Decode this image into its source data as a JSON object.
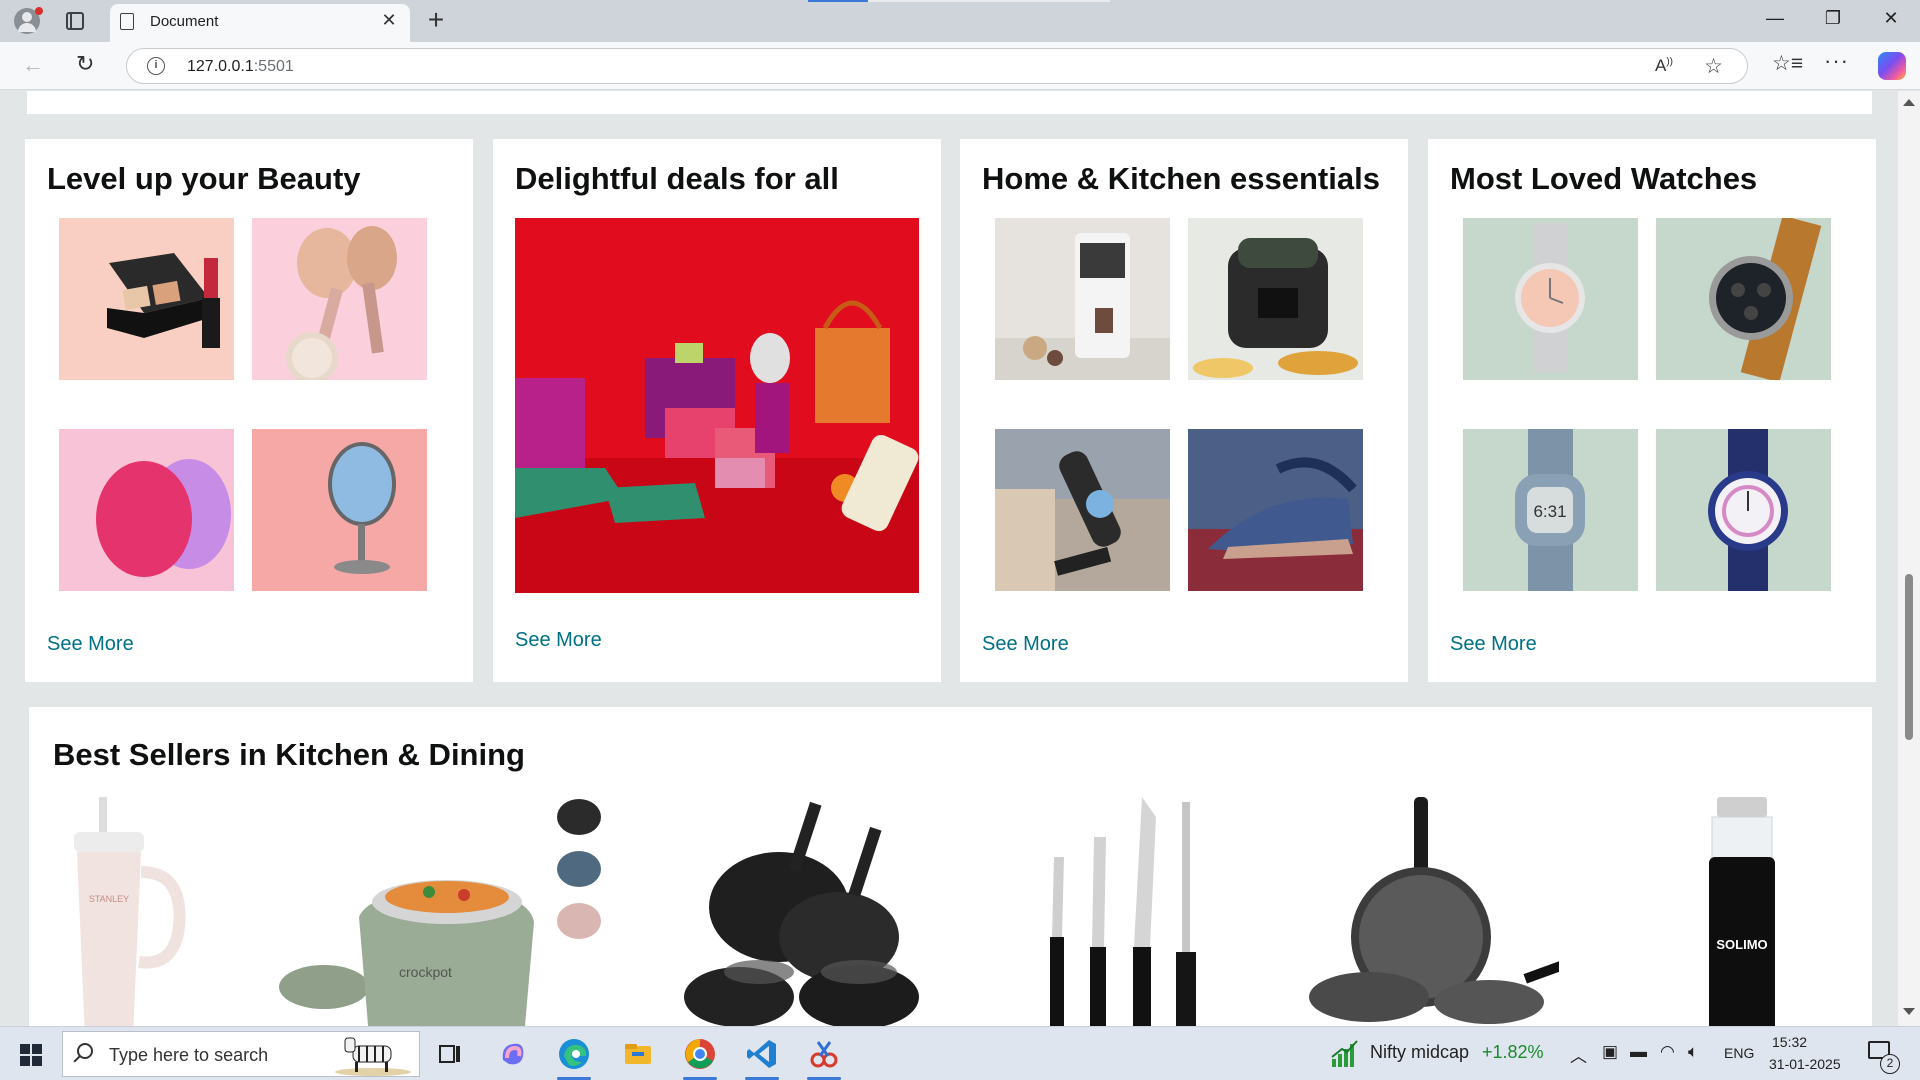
{
  "browser": {
    "tab_title": "Document",
    "tab_close": "✕",
    "new_tab": "+",
    "url_host": "127.0.0.1",
    "url_port": ":5501",
    "window_controls": {
      "minimize": "—",
      "restore": "❐",
      "close": "✕"
    }
  },
  "cards": [
    {
      "title": "Level up your Beauty",
      "see_more": "See More"
    },
    {
      "title": "Delightful deals for all",
      "see_more": "See More"
    },
    {
      "title": "Home & Kitchen essentials",
      "see_more": "See More"
    },
    {
      "title": "Most Loved Watches",
      "see_more": "See More"
    }
  ],
  "best_sellers": {
    "title": "Best Sellers in Kitchen & Dining",
    "stanley_text": "STANLEY",
    "crockpot_text": "crockpot",
    "solimo_text": "SOLIMO"
  },
  "taskbar": {
    "search_placeholder": "Type here to search",
    "widget_label": "Nifty midcap",
    "widget_value": "+1.82%",
    "language": "ENG",
    "time": "15:32",
    "date": "31-01-2025",
    "notification_count": "2"
  },
  "colors": {
    "link": "#007185",
    "page_bg": "#e3e6e6",
    "widget_positive": "#1a8a2c"
  }
}
